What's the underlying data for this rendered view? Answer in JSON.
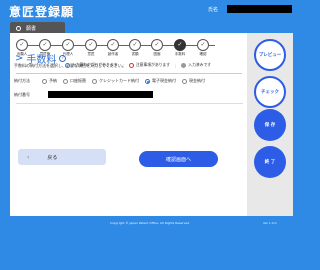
{
  "header": {
    "title": "意匠登録願",
    "name_label": "氏名"
  },
  "section_tab": {
    "label": "願書"
  },
  "steps": [
    {
      "label": "出願人",
      "mark": "✓",
      "current": false
    },
    {
      "label": "意匠権",
      "mark": "✓",
      "current": false
    },
    {
      "label": "代理人",
      "mark": "✓",
      "current": false
    },
    {
      "label": "意匠",
      "mark": "✓",
      "current": false
    },
    {
      "label": "創作者",
      "mark": "✓",
      "current": false
    },
    {
      "label": "書類",
      "mark": "✓",
      "current": false
    },
    {
      "label": "図面",
      "mark": "✓",
      "current": false
    },
    {
      "label": "手数料",
      "mark": "✓",
      "current": true
    },
    {
      "label": "確認",
      "mark": "✓",
      "current": false
    }
  ],
  "legend": {
    "optional": "入力漏れや誤りがあります",
    "required": "注意事項があります",
    "done": "入力済みです"
  },
  "fee_section": {
    "title": "手数料",
    "help": "?",
    "description": "手数料の納付方法を選択し、必要な項目を入力してください。",
    "method_label": "納付方法",
    "options": [
      {
        "label": "予納",
        "checked": false
      },
      {
        "label": "口座振替",
        "checked": false
      },
      {
        "label": "クレジットカード納付",
        "checked": false
      },
      {
        "label": "電子現金納付",
        "checked": true
      },
      {
        "label": "現金納付",
        "checked": false
      }
    ],
    "number_label": "納付番号"
  },
  "buttons": {
    "back_arrow": "‹",
    "back": "戻る",
    "next": "確認画面へ"
  },
  "sidebar": {
    "preview": "プレビュー",
    "check": "チェック",
    "save": "保 存",
    "finish": "終 了"
  },
  "footer": {
    "copyright": "Copyright © Japan Patent Office. All Rights Reserved.",
    "version": "Ver 1.0.0"
  },
  "colors": {
    "background": "#2f8ae6",
    "accent": "#2d5ce6",
    "sidebar": "#e8e8e8"
  }
}
